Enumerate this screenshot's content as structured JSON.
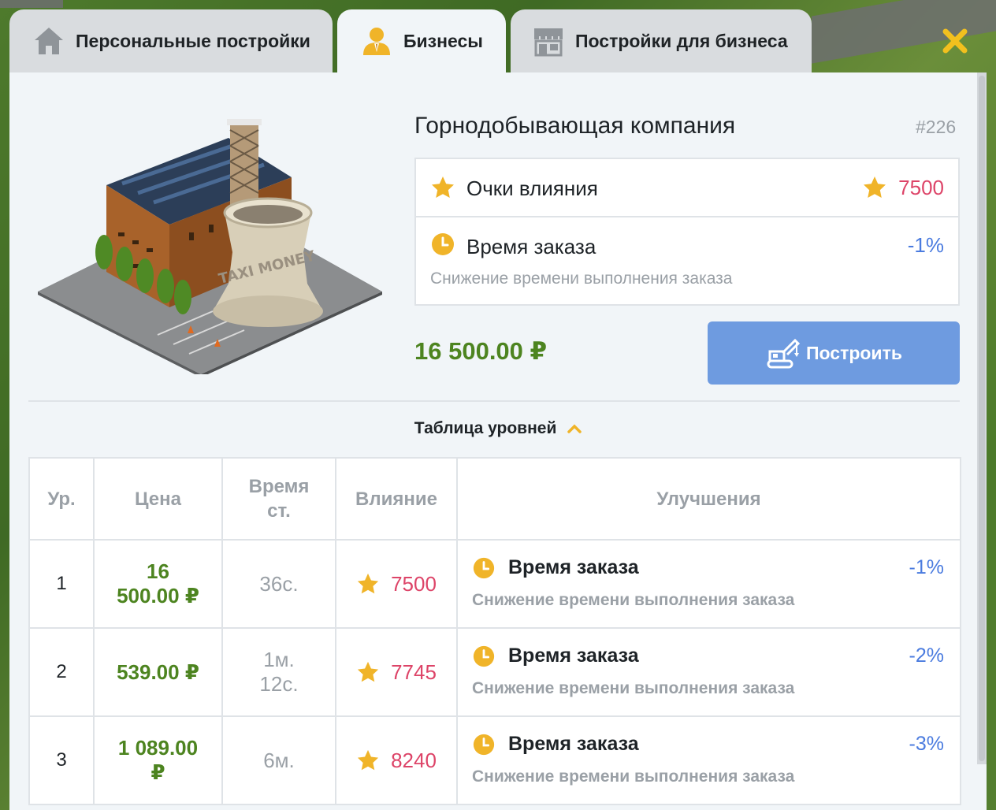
{
  "tabs": [
    {
      "label": "Персональные постройки",
      "icon": "house-icon",
      "active": false
    },
    {
      "label": "Бизнесы",
      "icon": "businessman-icon",
      "active": true
    },
    {
      "label": "Постройки для бизнеса",
      "icon": "shop-icon",
      "active": false
    }
  ],
  "colors": {
    "accent_gold": "#f0b429",
    "price_green": "#4d8420",
    "influence_red": "#dd4468",
    "percent_blue": "#4a7bdf",
    "button_blue": "#6e9be0",
    "close_yellow": "#f2c01e"
  },
  "business": {
    "title": "Горнодобывающая компания",
    "id": "#226",
    "influence_label": "Очки влияния",
    "influence_value": "7500",
    "time_label": "Время заказа",
    "time_value": "-1%",
    "time_desc": "Снижение времени выполнения заказа",
    "price": "16 500.00 ₽",
    "build_label": "Построить",
    "building_sign": "TAXI MONEY"
  },
  "levels": {
    "toggle_label": "Таблица уровней",
    "headers": {
      "level": "Ур.",
      "price": "Цена",
      "time_line1": "Время",
      "time_line2": "ст.",
      "influence": "Влияние",
      "improvements": "Улучшения"
    },
    "rows": [
      {
        "level": "1",
        "price_line1": "16",
        "price_line2": "500.00 ₽",
        "time_line1": "36с.",
        "time_line2": "",
        "influence": "7500",
        "imp_title": "Время заказа",
        "imp_value": "-1%",
        "imp_desc": "Снижение времени выполнения заказа"
      },
      {
        "level": "2",
        "price_line1": "539.00 ₽",
        "price_line2": "",
        "time_line1": "1м.",
        "time_line2": "12с.",
        "influence": "7745",
        "imp_title": "Время заказа",
        "imp_value": "-2%",
        "imp_desc": "Снижение времени выполнения заказа"
      },
      {
        "level": "3",
        "price_line1": "1 089.00",
        "price_line2": "₽",
        "time_line1": "6м.",
        "time_line2": "",
        "influence": "8240",
        "imp_title": "Время заказа",
        "imp_value": "-3%",
        "imp_desc": "Снижение времени выполнения заказа"
      }
    ]
  }
}
